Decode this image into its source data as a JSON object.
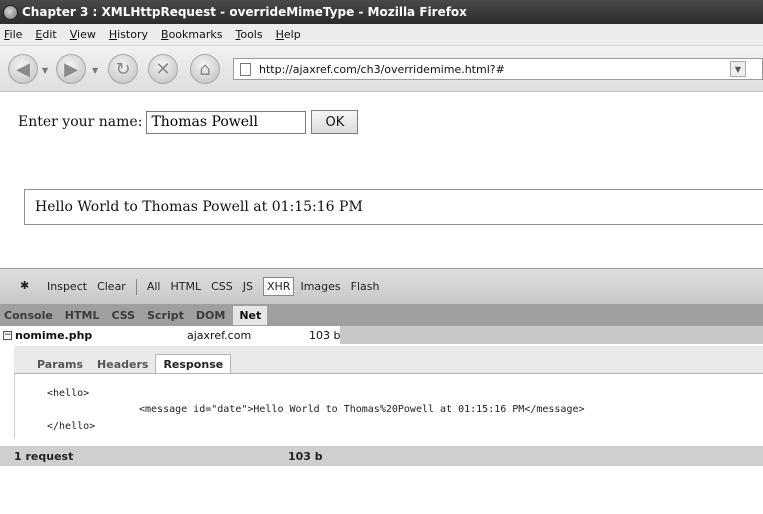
{
  "window": {
    "title": "Chapter 3 : XMLHttpRequest - overrideMimeType - Mozilla Firefox"
  },
  "menu": [
    "File",
    "Edit",
    "View",
    "History",
    "Bookmarks",
    "Tools",
    "Help"
  ],
  "nav": {
    "url": "http://ajaxref.com/ch3/overridemime.html?#"
  },
  "page": {
    "name_label": "Enter your name:",
    "name_value": "Thomas Powell",
    "ok_label": "OK",
    "message": "Hello World to Thomas Powell at 01:15:16 PM"
  },
  "firebug": {
    "toolbar": {
      "inspect": "Inspect",
      "clear": "Clear",
      "filters": [
        "All",
        "HTML",
        "CSS",
        "JS",
        "XHR",
        "Images",
        "Flash"
      ],
      "active_filter": "XHR"
    },
    "tabs": [
      "Console",
      "HTML",
      "CSS",
      "Script",
      "DOM",
      "Net"
    ],
    "active_tab": "Net",
    "request": {
      "file": "nomime.php",
      "host": "ajaxref.com",
      "size": "103 b"
    },
    "subtabs": [
      "Params",
      "Headers",
      "Response"
    ],
    "active_subtab": "Response",
    "response_lines": [
      "<hello>",
      "<message id=\"date\">Hello World to Thomas%20Powell at 01:15:16 PM</message>",
      "</hello>"
    ],
    "footer": {
      "requests": "1 request",
      "total": "103 b"
    }
  }
}
